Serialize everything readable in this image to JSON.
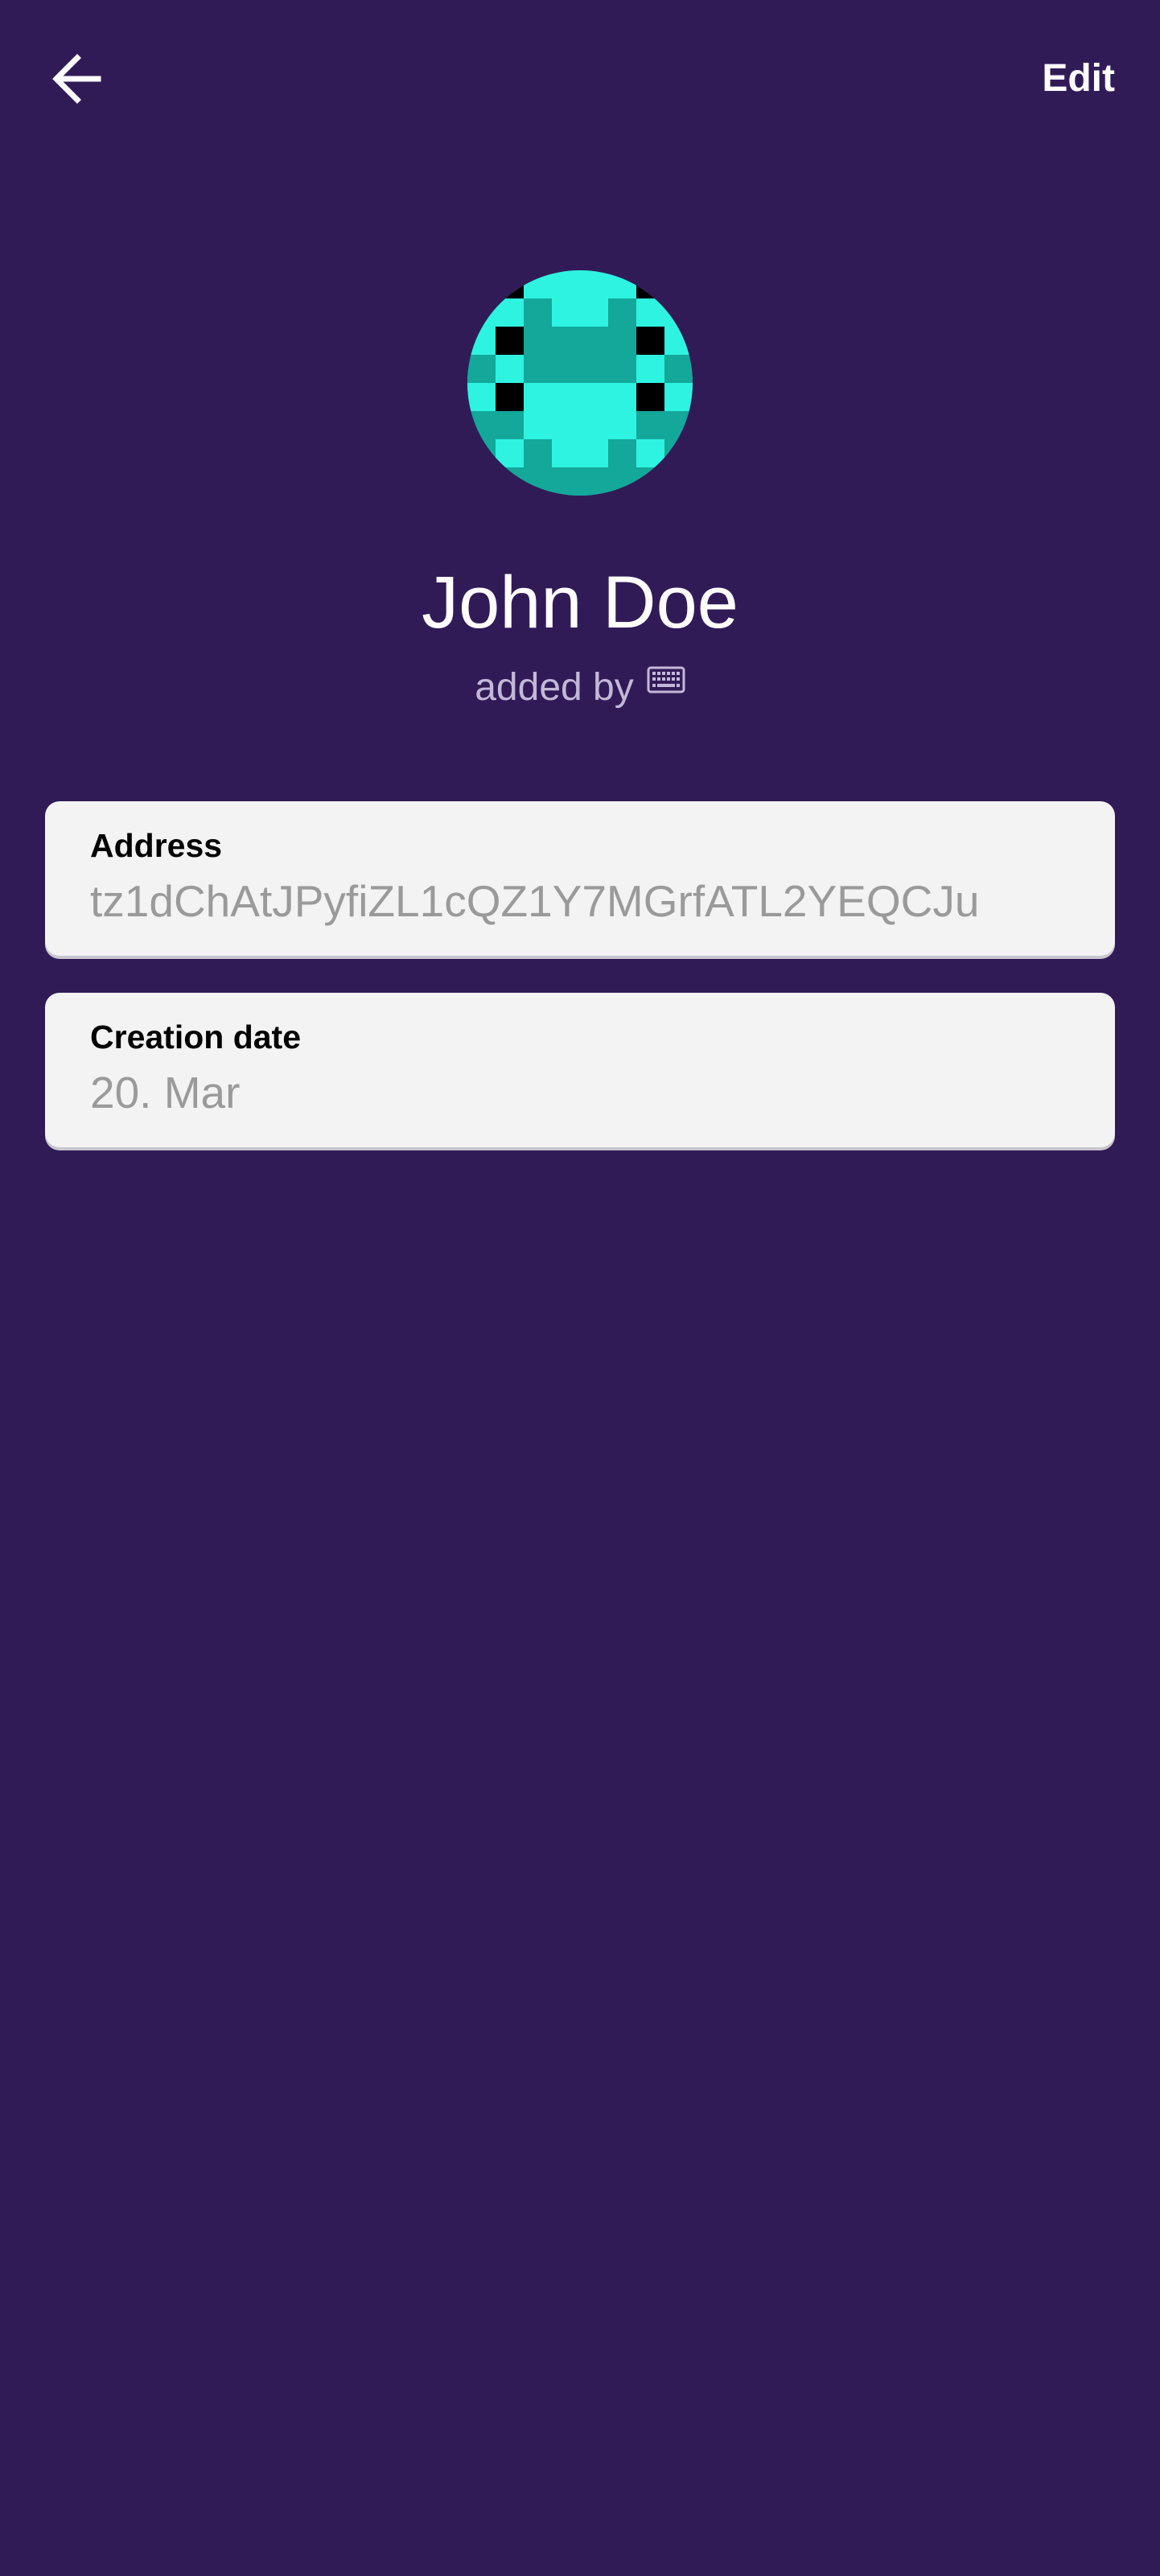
{
  "header": {
    "back_icon": "arrow-left-icon",
    "edit_label": "Edit"
  },
  "contact": {
    "avatar_icon": "identicon-avatar",
    "avatar_colors": [
      "#2ef3e0",
      "#13a89a",
      "#000000"
    ],
    "name": "John Doe",
    "added_by_label": "added by",
    "added_by_icon": "keyboard-icon"
  },
  "details": {
    "address": {
      "label": "Address",
      "value": "tz1dChAtJPyfiZL1cQZ1Y7MGrfATL2YEQCJu"
    },
    "creation_date": {
      "label": "Creation date",
      "value": "20. Mar"
    }
  },
  "colors": {
    "background": "#311b57",
    "card": "#f3f3f3",
    "value_text": "#9a9a9a"
  }
}
